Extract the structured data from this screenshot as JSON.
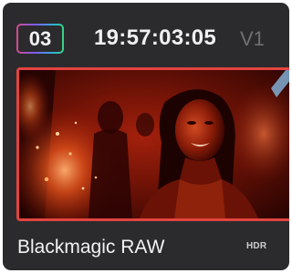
{
  "clip": {
    "number": "03",
    "timecode": "19:57:03:05",
    "track": "V1",
    "codec": "Blackmagic RAW",
    "badge": "HDR"
  },
  "colors": {
    "card_background": "#2b2b2d",
    "selection_border": "#e2443f",
    "timecode_text": "#f0f0f0",
    "track_text": "#6f6f72"
  },
  "icons": {
    "thumbnail": "clip-thumbnail-image"
  }
}
